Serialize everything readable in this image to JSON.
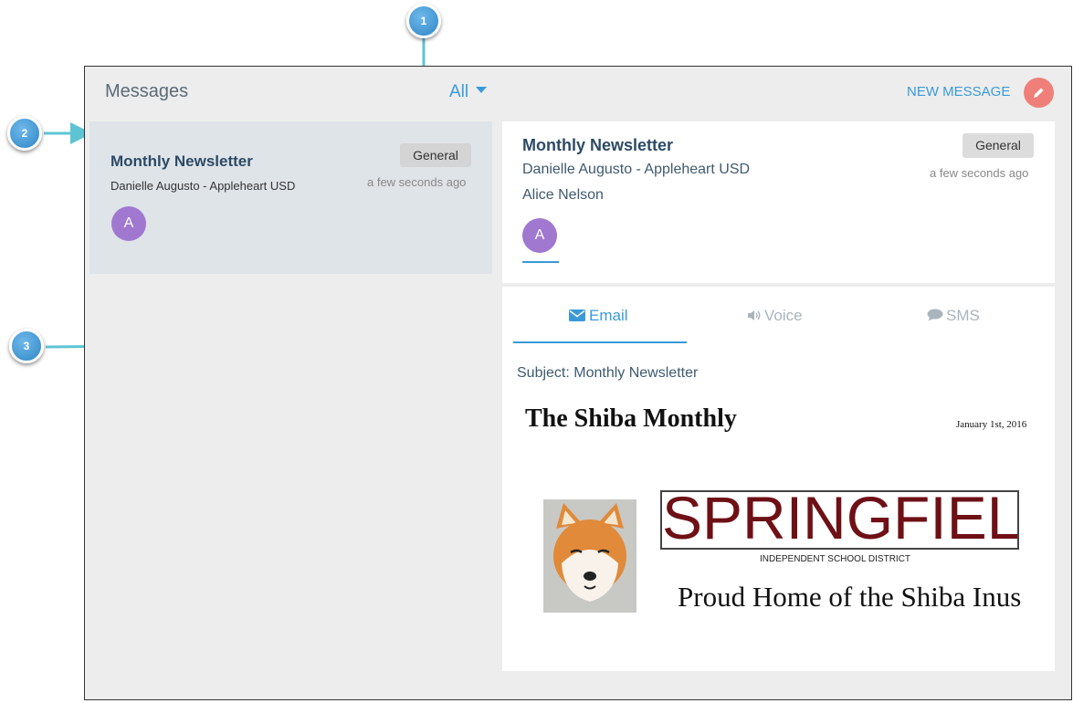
{
  "header": {
    "title": "Messages",
    "filter_value": "All",
    "new_message_label": "NEW MESSAGE"
  },
  "message_list": [
    {
      "title": "Monthly Newsletter",
      "sender": "Danielle Augusto - Appleheart USD",
      "badge": "General",
      "time": "a few seconds ago",
      "avatar": "A"
    }
  ],
  "detail": {
    "title": "Monthly Newsletter",
    "sender": "Danielle Augusto - Appleheart USD",
    "recipient": "Alice Nelson",
    "badge": "General",
    "time": "a few seconds ago",
    "avatar": "A",
    "tabs": [
      {
        "label": "Email",
        "icon": "envelope-icon",
        "active": true
      },
      {
        "label": "Voice",
        "icon": "speaker-icon",
        "active": false
      },
      {
        "label": "SMS",
        "icon": "chat-bubble-icon",
        "active": false
      }
    ],
    "subject": "Subject: Monthly Newsletter",
    "newsletter": {
      "title": "The Shiba Monthly",
      "date": "January 1st, 2016",
      "logo_text": "SPRINGFIELD",
      "district": "INDEPENDENT SCHOOL DISTRICT",
      "tagline": "Proud Home of the Shiba Inus"
    }
  },
  "callouts": [
    "1",
    "2",
    "3"
  ],
  "colors": {
    "accent": "#3a9ad9",
    "new_message_button": "#f07f7a",
    "avatar": "#a078d0",
    "selected_item": "#dfe4e9",
    "title_text": "#2c4a66",
    "logo_red": "#6e1016",
    "callout_line": "#5ec4d4"
  }
}
